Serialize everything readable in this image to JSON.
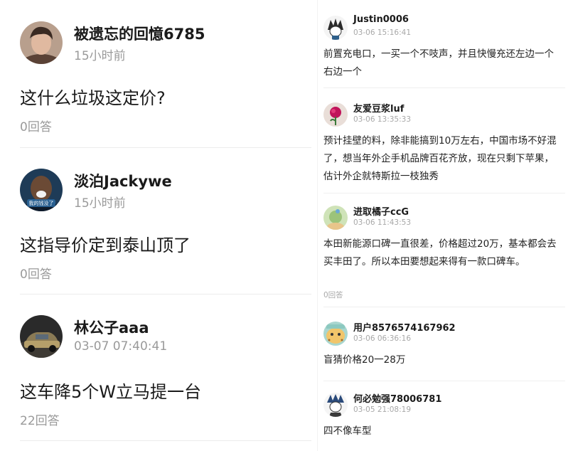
{
  "left_posts": [
    {
      "user": "被遗忘的回憶6785",
      "time": "15小时前",
      "text": "这什么垃圾这定价?",
      "answers": "0回答"
    },
    {
      "user": "淡泊Jackywe",
      "time": "15小时前",
      "text": "这指导价定到泰山顶了",
      "answers": "0回答",
      "avatar_caption": "我的钱没了"
    },
    {
      "user": "林公子aaa",
      "time": "03-07 07:40:41",
      "text": "这车降5个W立马提一台",
      "answers": "22回答"
    }
  ],
  "right_posts": [
    {
      "user": "Justin0006",
      "time": "03-06 15:16:41",
      "text": "前置充电口，一买一个不吱声，并且快慢充还左边一个右边一个"
    },
    {
      "user": "友爱豆浆luf",
      "time": "03-06 13:35:33",
      "text": "预计挂壁的料，除非能搞到10万左右，中国市场不好混了，想当年外企手机品牌百花齐放，现在只剩下苹果，估计外企就特斯拉一枝独秀"
    },
    {
      "user": "进取橘子ccG",
      "time": "03-06 11:43:53",
      "text": "本田新能源口碑一直很差，价格超过20万，基本都会去买丰田了。所以本田要想起来得有一款口碑车。",
      "answers": "0回答"
    },
    {
      "user": "用户8576574167962",
      "time": "03-06 06:36:16",
      "text": "盲猜价格20一28万"
    },
    {
      "user": "何必勉强78006781",
      "time": "03-05 21:08:19",
      "text": "四不像车型"
    }
  ]
}
